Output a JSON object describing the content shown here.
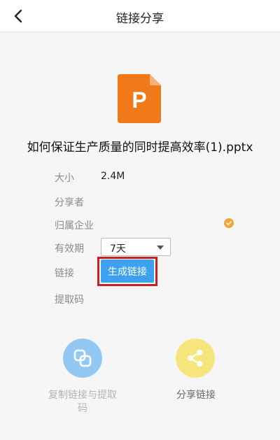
{
  "header": {
    "title": "链接分享",
    "back_icon": "chevron-left-icon"
  },
  "file": {
    "icon": "pptx-file-icon",
    "icon_letter": "P",
    "icon_color": "#f07a1a",
    "name": "如何保证生产质量的同时提高效率(1).pptx"
  },
  "details": {
    "size_label": "大小",
    "size_value": "2.4M",
    "sharer_label": "分享者",
    "company_label": "归属企业",
    "validity_label": "有效期",
    "validity_value": "7天",
    "link_label": "链接",
    "generate_button": "生成链接",
    "code_label": "提取码"
  },
  "actions": {
    "copy_label": "复制链接与提取码",
    "copy_icon": "copy-icon",
    "copy_color": "#93c8f3",
    "share_label": "分享链接",
    "share_icon": "share-icon",
    "share_color": "#f7e57d"
  },
  "colors": {
    "accent": "#3ea1ef",
    "highlight": "#c8211f",
    "badge": "#f0a63a"
  }
}
